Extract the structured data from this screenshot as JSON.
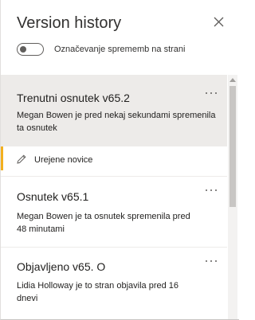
{
  "panel": {
    "title": "Version history",
    "close_icon": "close-icon",
    "toggle_label": "Označevanje sprememb na strani",
    "toggle_on": false
  },
  "versions": [
    {
      "title": "Trenutni osnutek v65.2",
      "description": "Megan Bowen je pred nekaj sekundami spremenila ta osnutek",
      "selected": true,
      "more_icon": "more-options-icon",
      "changes": [
        {
          "label": "Urejene novice",
          "icon": "pencil-icon"
        }
      ]
    },
    {
      "title": "Osnutek v65.1",
      "description": "Megan Bowen je ta osnutek spremenila pred 48 minutami",
      "selected": false,
      "more_icon": "more-options-icon"
    },
    {
      "title": "Objavljeno v65. O",
      "description": "Lidia Holloway je to stran objavila pred 16 dnevi",
      "selected": false,
      "more_icon": "more-options-icon"
    }
  ],
  "colors": {
    "selected_bg": "#edebe9",
    "accent": "#f2b01e",
    "text": "#201f1e"
  }
}
